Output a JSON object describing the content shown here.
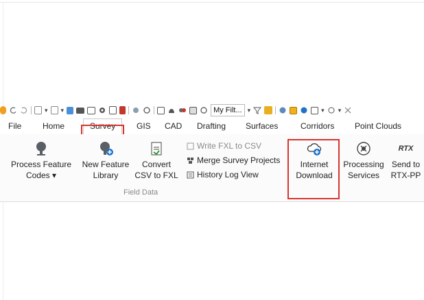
{
  "quick_access": {
    "filter_value": "My Filt...",
    "icons": [
      "app-icon",
      "undo-icon",
      "redo-icon",
      "open-icon",
      "save-icon",
      "new-icon",
      "folder-icon",
      "print-icon",
      "settings-icon",
      "layer-icon",
      "globe-icon",
      "circle-icon",
      "grid-icon",
      "cube-icon",
      "dome-icon",
      "image-icon",
      "link-icon",
      "filter-icon",
      "tag-icon",
      "folder-open-icon",
      "shield-icon",
      "select-icon",
      "cube2-icon",
      "view-icon",
      "measure-icon"
    ]
  },
  "tabs": [
    "File",
    "Home",
    "Survey",
    "GIS",
    "CAD",
    "Drafting",
    "Surfaces",
    "Corridors",
    "Point Clouds"
  ],
  "active_tab": "Survey",
  "ribbon": {
    "process_feature_codes": {
      "line1": "Process Feature",
      "line2": "Codes"
    },
    "new_feature_library": {
      "line1": "New Feature",
      "line2": "Library"
    },
    "convert_csv": {
      "line1": "Convert",
      "line2": "CSV to FXL"
    },
    "write_fxl": "Write FXL to CSV",
    "merge_survey": "Merge Survey Projects",
    "history_log": "History Log View",
    "group_label": "Field Data",
    "internet_download": {
      "line1": "Internet",
      "line2": "Download"
    },
    "processing_services": {
      "line1": "Processing",
      "line2": "Services"
    },
    "send_to_rtx": {
      "line1": "Send to",
      "line2": "RTX-PP"
    },
    "rtx_logo": "RTX"
  },
  "colors": {
    "highlight": "#d9322e",
    "accent": "#1e73c8"
  }
}
